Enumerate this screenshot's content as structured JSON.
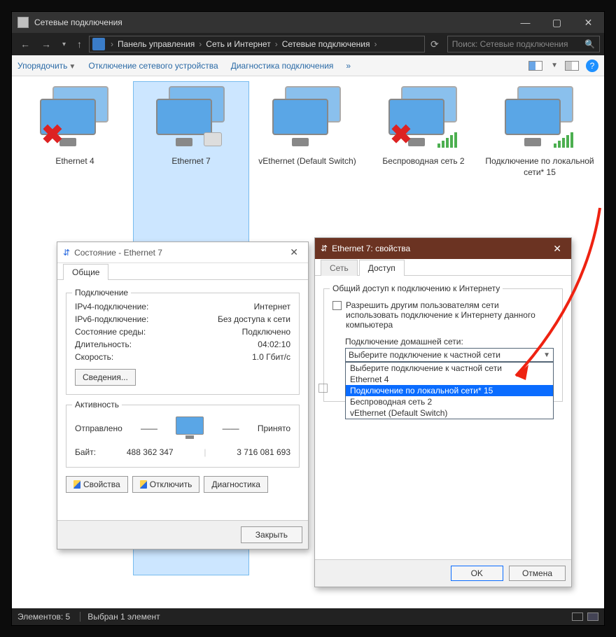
{
  "window": {
    "title": "Сетевые подключения"
  },
  "breadcrumb": {
    "items": [
      "Панель управления",
      "Сеть и Интернет",
      "Сетевые подключения"
    ]
  },
  "search": {
    "placeholder": "Поиск: Сетевые подключения"
  },
  "toolbar": {
    "organize": "Упорядочить",
    "disable": "Отключение сетевого устройства",
    "diagnose": "Диагностика подключения",
    "more": "»"
  },
  "connections": [
    {
      "label": "Ethernet 4",
      "disabled": true
    },
    {
      "label": "Ethernet 7",
      "selected": true,
      "plug": true
    },
    {
      "label": "vEthernet (Default Switch)"
    },
    {
      "label": "Беспроводная сеть 2",
      "disabled": true,
      "wifi": true
    },
    {
      "label": "Подключение по локальной сети* 15",
      "wifi": true
    }
  ],
  "statusbar": {
    "count": "Элементов: 5",
    "selected": "Выбран 1 элемент"
  },
  "statusDialog": {
    "title": "Состояние - Ethernet 7",
    "tab": "Общие",
    "group1": "Подключение",
    "rows": [
      {
        "k": "IPv4-подключение:",
        "v": "Интернет"
      },
      {
        "k": "IPv6-подключение:",
        "v": "Без доступа к сети"
      },
      {
        "k": "Состояние среды:",
        "v": "Подключено"
      },
      {
        "k": "Длительность:",
        "v": "04:02:10"
      },
      {
        "k": "Скорость:",
        "v": "1.0 Гбит/с"
      }
    ],
    "detailsBtn": "Сведения...",
    "group2": "Активность",
    "sent": "Отправлено",
    "recv": "Принято",
    "bytesLabel": "Байт:",
    "bytesSent": "488 362 347",
    "bytesRecv": "3 716 081 693",
    "btns": {
      "props": "Свойства",
      "disable": "Отключить",
      "diag": "Диагностика"
    },
    "close": "Закрыть"
  },
  "propsDialog": {
    "title": "Ethernet 7: свойства",
    "tabs": {
      "net": "Сеть",
      "share": "Доступ"
    },
    "groupTitle": "Общий доступ к подключению к Интернету",
    "allow": "Разрешить другим пользователям сети использовать подключение к Интернету данного компьютера",
    "homeLabel": "Подключение домашней сети:",
    "comboValue": "Выберите подключение к частной сети",
    "options": [
      "Выберите подключение к частной сети",
      "Ethernet 4",
      "Подключение по локальной сети* 15",
      "Беспроводная сеть 2",
      "vEthernet (Default Switch)"
    ],
    "ok": "OK",
    "cancel": "Отмена"
  }
}
